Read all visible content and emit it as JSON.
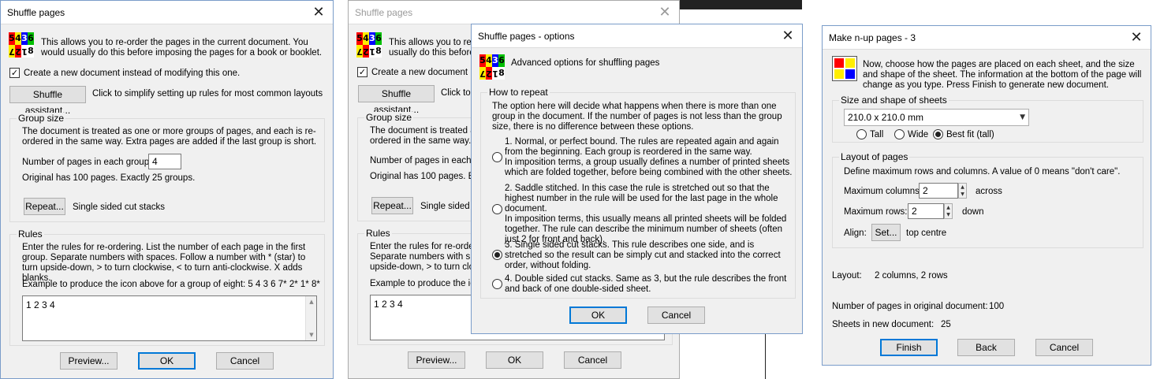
{
  "icon_names": {
    "shuffle": "shuffle-pages-icon",
    "nup": "nup-layout-icon",
    "close": "close-icon"
  },
  "colors": {
    "default_button_border": "#0078d7",
    "icon_red": "#ff0000",
    "icon_yellow": "#ffee00",
    "icon_blue": "#0000ff",
    "icon_green": "#00c000"
  },
  "shuffle_icon": {
    "top": [
      "5",
      "4",
      "3",
      "6"
    ],
    "bottom": [
      "7",
      "2",
      "1",
      "8"
    ]
  },
  "dialog1": {
    "title": "Shuffle pages",
    "intro": "This allows you to re-order the pages in the current document. You would usually do this before imposing the pages for a book or booklet.",
    "create_new_label": "Create a new document instead of modifying this one.",
    "create_new_checked": true,
    "assistant_button": "Shuffle assistant...",
    "assistant_hint": "Click to simplify setting up rules for most common layouts",
    "group_size": {
      "label": "Group size",
      "desc": "The document is treated as one or more groups of pages, and each is re-ordered in the same way. Extra pages are added if the last group is short.",
      "pages_label": "Number of pages in each group:",
      "pages_value": "4",
      "original_info": "Original has 100 pages. Exactly 25 groups.",
      "repeat_button": "Repeat...",
      "repeat_value": "Single sided cut stacks"
    },
    "rules": {
      "label": "Rules",
      "desc": "Enter the rules for re-ordering. List the number of each page in the first group. Separate numbers with spaces. Follow a number with * (star)  to turn upside-down, > to turn clockwise, < to turn anti-clockwise. X adds blanks.",
      "example": "Example to produce the icon above for a group of eight: 5 4 3 6 7* 2* 1* 8*",
      "value": "1 2 3 4"
    },
    "preview_button": "Preview...",
    "ok_button": "OK",
    "cancel_button": "Cancel"
  },
  "dialog2": {
    "title": "Shuffle pages",
    "intro": "This allows you to re-o",
    "intro2": "usually do this before i",
    "create_new_label": "Create a new document inst",
    "assistant_button": "Shuffle assistant...",
    "assistant_hint": "Click to",
    "group_label": "Group size",
    "group_desc1": "The document is treated as",
    "group_desc2": "ordered in the same way. Ext",
    "pages_label": "Number of pages in each gro",
    "original_info": "Original has 100 pages. Exac",
    "repeat_button": "Repeat...",
    "repeat_value": "Single sided c",
    "rules_label": "Rules",
    "rules_desc1": "Enter the rules for re-ordering",
    "rules_desc2": "Separate numbers with spac",
    "rules_desc3": "upside-down, > to turn clock",
    "example": "Example to produce the icc",
    "value": "1 2 3 4",
    "preview_button": "Preview...",
    "ok_button": "OK",
    "cancel_button": "Cancel"
  },
  "dialog_options": {
    "title": "Shuffle pages - options",
    "header": "Advanced options for shuffling pages",
    "group_label": "How to repeat",
    "desc": "The option here will decide what happens when there is more than one group in the document. If the number of pages is not less than the group size, there is no difference between these options.",
    "options": [
      {
        "text": "1. Normal, or perfect bound. The rules are repeated again and again from the beginning. Each group is reordered in the same way.\nIn imposition terms, a group usually defines a number of printed sheets which are folded together, before being combined with the other sheets.",
        "selected": false
      },
      {
        "text": "2. Saddle stitched. In this case the rule is stretched out so that the highest number in the rule will be used for the last page in the whole document.\nIn imposition terms, this usually means all printed sheets will be folded together. The rule can describe the minimum number of sheets (often just 2 for front and back).",
        "selected": false
      },
      {
        "text": "3. Single sided cut stacks. This rule describes one side, and is stretched so the result can be simply cut and stacked into the correct order, without folding.",
        "selected": true
      },
      {
        "text": "4. Double sided cut stacks. Same as 3, but the rule describes the front and back of one double-sided sheet.",
        "selected": false
      }
    ],
    "ok_button": "OK",
    "cancel_button": "Cancel"
  },
  "dialog_nup": {
    "title": "Make n-up pages - 3",
    "intro": "Now, choose how the pages are placed on each sheet, and the size and shape of the sheet. The information at the bottom of the page will change as you type. Press Finish to generate new document.",
    "size_group": {
      "label": "Size and shape of sheets",
      "selected": "210.0 x 210.0 mm",
      "orientation": [
        {
          "label": "Tall",
          "selected": false
        },
        {
          "label": "Wide",
          "selected": false
        },
        {
          "label": "Best fit (tall)",
          "selected": true
        }
      ]
    },
    "layout_group": {
      "label": "Layout of pages",
      "desc": "Define maximum rows and columns. A value of 0 means \"don't care\".",
      "max_cols_label": "Maximum columns:",
      "max_cols_value": "2",
      "across": "across",
      "max_rows_label": "Maximum rows:",
      "max_rows_value": "2",
      "down": "down",
      "align_label": "Align:",
      "align_button": "Set...",
      "align_value": "top centre"
    },
    "layout_label": "Layout:",
    "layout_value": "2 columns, 2 rows",
    "orig_pages_label": "Number of pages in original document:",
    "orig_pages_value": "100",
    "sheets_label": "Sheets in new document:",
    "sheets_value": "25",
    "finish_button": "Finish",
    "back_button": "Back",
    "cancel_button": "Cancel"
  }
}
